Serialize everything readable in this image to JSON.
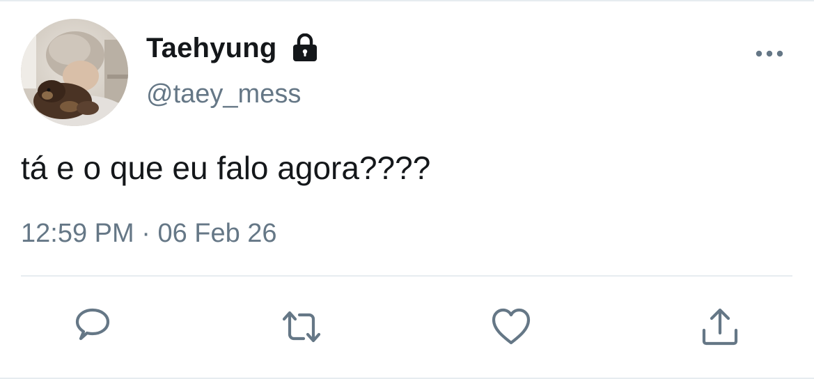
{
  "tweet": {
    "author": {
      "display_name": "Taehyung",
      "handle": "@taey_mess",
      "protected_icon": "lock-icon",
      "avatar": "avatar"
    },
    "text": "tá e o que eu falo agora????",
    "time": "12:59 PM",
    "separator": "·",
    "date": "06 Feb 26",
    "more_icon": "more-horizontal-icon",
    "actions": [
      {
        "name": "reply",
        "icon": "reply-icon"
      },
      {
        "name": "retweet",
        "icon": "retweet-icon"
      },
      {
        "name": "like",
        "icon": "heart-icon"
      },
      {
        "name": "share",
        "icon": "share-icon"
      }
    ]
  },
  "colors": {
    "text_primary": "#14171a",
    "text_secondary": "#657786",
    "divider": "#e6ecf0",
    "background": "#ffffff"
  }
}
